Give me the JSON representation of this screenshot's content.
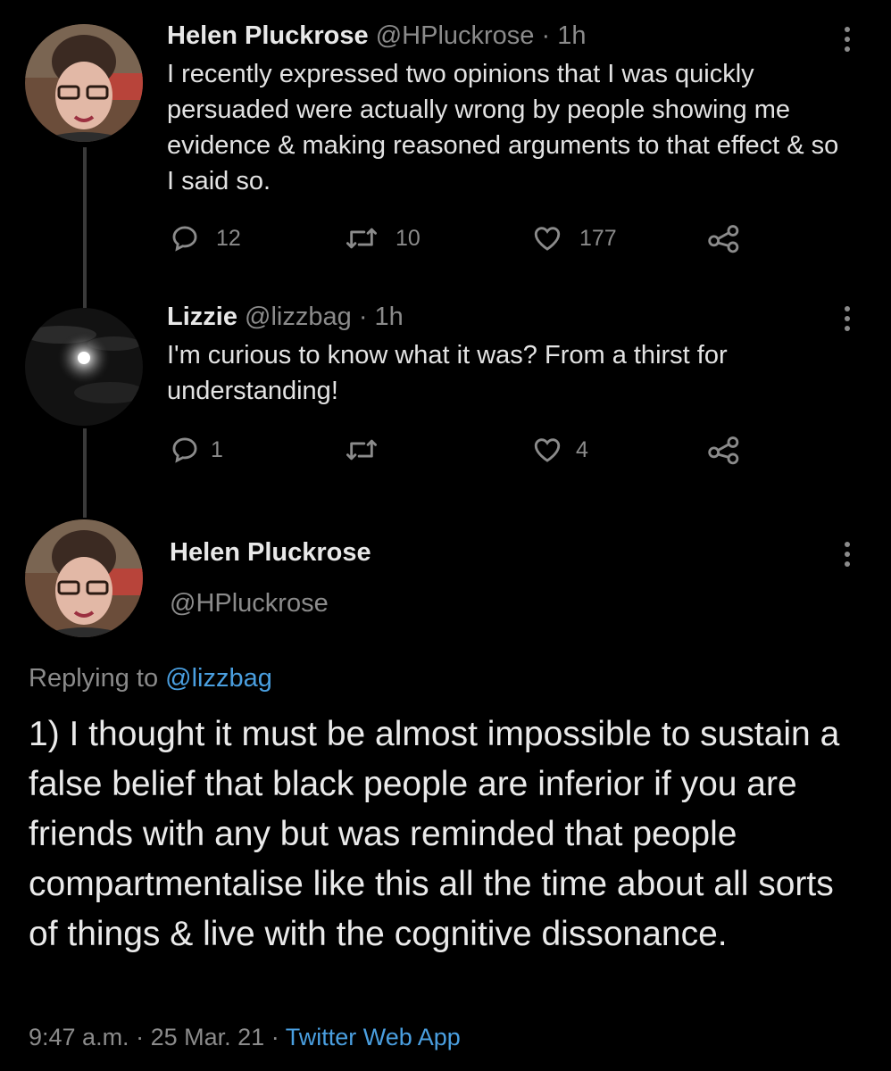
{
  "tweets": [
    {
      "name": "Helen Pluckrose",
      "handle": "@HPluckrose",
      "sep": "·",
      "time": "1h",
      "text": "I recently expressed two opinions that I was quickly persuaded were actually wrong by people showing me evidence & making reasoned arguments to that effect & so I said so.",
      "replies": "12",
      "retweets": "10",
      "likes": "177"
    },
    {
      "name": "Lizzie",
      "handle": "@lizzbag",
      "sep": "·",
      "time": "1h",
      "text": "I'm curious to know what it was?  From a thirst for understanding!",
      "replies": "1",
      "retweets": "",
      "likes": "4"
    }
  ],
  "main": {
    "name": "Helen Pluckrose",
    "handle": "@HPluckrose",
    "replying_prefix": "Replying to",
    "replying_handle": "@lizzbag",
    "text": "1) I thought it must be almost impossible to sustain a false belief that black people are inferior if you are friends with any but was reminded that people compartmentalise like this all the time about all sorts of things & live with the cognitive dissonance.",
    "time": "9:47 a.m.",
    "sep1": "·",
    "date": "25 Mar. 21",
    "sep2": "·",
    "source": "Twitter Web App"
  },
  "colors": {
    "background": "#000000",
    "text": "#e3e3e3",
    "muted": "#8b8b8b",
    "link": "#4a9fe0"
  }
}
